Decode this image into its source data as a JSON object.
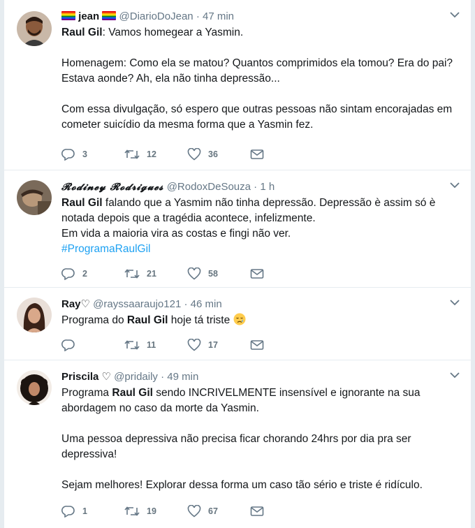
{
  "tweets": [
    {
      "name": "jean",
      "handle": "@DiarioDoJean",
      "time": "47 min",
      "text_parts": [
        {
          "t": "Raul Gil",
          "b": true
        },
        {
          "t": ": Vamos homegear a Yasmin.\n\nHomenagem: Como ela se matou? Quantos comprimidos ela tomou? Era do pai? Estava aonde? Ah, ela não tinha depressão...\n\nCom essa divulgação, só espero que outras pessoas não sintam encorajadas em cometer suicídio da mesma forma que a Yasmin fez."
        }
      ],
      "replies": "3",
      "retweets": "12",
      "likes": "36"
    },
    {
      "name": "𝓡𝓸𝓭𝓲𝓷𝓮𝔂 𝓡𝓸𝓭𝓻𝓲𝓰𝓾𝓮𝓼",
      "handle": "@RodoxDeSouza",
      "time": "1 h",
      "text_parts": [
        {
          "t": "Raul Gil",
          "b": true
        },
        {
          "t": " falando que a Yasmim não tinha depressão. Depressão è assim só è notada depois que a tragédia acontece, infelizmente.\nEm vida a maioria vira as costas e fingi não ver.\n"
        },
        {
          "t": "#ProgramaRaulGil",
          "h": true
        }
      ],
      "replies": "2",
      "retweets": "21",
      "likes": "58"
    },
    {
      "name": "Ray",
      "name_suffix": "♡",
      "handle": "@rayssaaraujo121",
      "time": "46 min",
      "text_parts": [
        {
          "t": "Programa do "
        },
        {
          "t": "Raul Gil",
          "b": true
        },
        {
          "t": " hoje tá triste "
        }
      ],
      "emoji": "crying-face",
      "replies": "",
      "retweets": "11",
      "likes": "17"
    },
    {
      "name": "Priscila",
      "name_suffix": "♡",
      "handle": "@pridaily",
      "time": "49 min",
      "text_parts": [
        {
          "t": "Programa "
        },
        {
          "t": "Raul Gil",
          "b": true
        },
        {
          "t": " sendo INCRIVELMENTE insensível e ignorante na sua abordagem no caso da morte da Yasmin.\n\nUma pessoa depressiva não precisa ficar chorando 24hrs por dia pra ser depressiva!\n\nSejam melhores! Explorar dessa forma um caso tão sério e triste é ridículo."
        }
      ],
      "replies": "1",
      "retweets": "19",
      "likes": "67"
    }
  ],
  "dot": "·",
  "icons": {
    "reply": "reply-icon",
    "retweet": "retweet-icon",
    "like": "heart-icon",
    "dm": "envelope-icon",
    "more": "chevron-down-icon",
    "flag": "rainbow-flag-icon"
  },
  "colors": {
    "text": "#14171a",
    "muted": "#657786",
    "link": "#1da1f2",
    "divider": "#e6ecf0"
  }
}
